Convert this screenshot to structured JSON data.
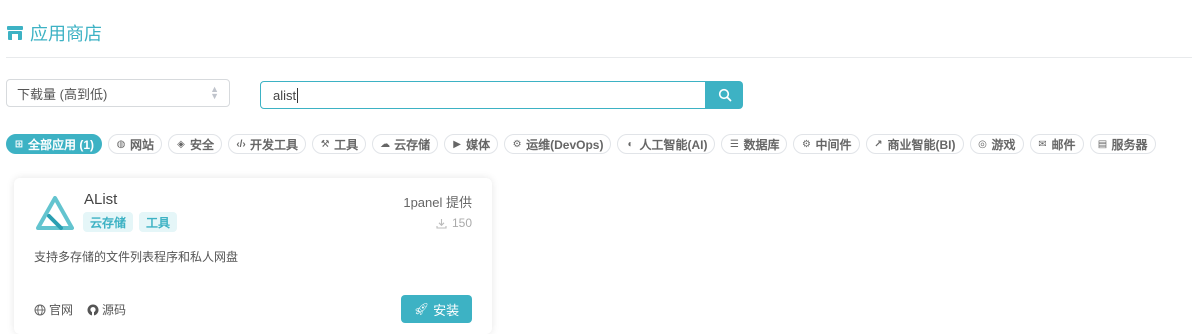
{
  "header": {
    "title": "应用商店",
    "icon": "store-icon"
  },
  "sort": {
    "selected": "下载量 (高到低)"
  },
  "search": {
    "value": "alist"
  },
  "tags": [
    {
      "label": "全部应用 (1)",
      "icon": "grid-icon",
      "active": true
    },
    {
      "label": "网站",
      "icon": "globe-icon"
    },
    {
      "label": "安全",
      "icon": "shield-icon"
    },
    {
      "label": "开发工具",
      "icon": "code-icon"
    },
    {
      "label": "工具",
      "icon": "wrench-icon"
    },
    {
      "label": "云存储",
      "icon": "cloud-icon"
    },
    {
      "label": "媒体",
      "icon": "video-icon"
    },
    {
      "label": "运维(DevOps)",
      "icon": "gears-icon"
    },
    {
      "label": "人工智能(AI)",
      "icon": "brain-icon"
    },
    {
      "label": "数据库",
      "icon": "database-icon"
    },
    {
      "label": "中间件",
      "icon": "gears-icon"
    },
    {
      "label": "商业智能(BI)",
      "icon": "chart-icon"
    },
    {
      "label": "游戏",
      "icon": "gamepad-icon"
    },
    {
      "label": "邮件",
      "icon": "mail-icon"
    },
    {
      "label": "服务器",
      "icon": "server-icon"
    }
  ],
  "app": {
    "name": "AList",
    "tags": [
      "云存储",
      "工具"
    ],
    "provider": "1panel 提供",
    "downloads": "150",
    "description": "支持多存储的文件列表程序和私人网盘",
    "links": {
      "website": "官网",
      "source": "源码"
    },
    "install": "安装"
  },
  "colors": {
    "accent": "#3db2c4"
  }
}
